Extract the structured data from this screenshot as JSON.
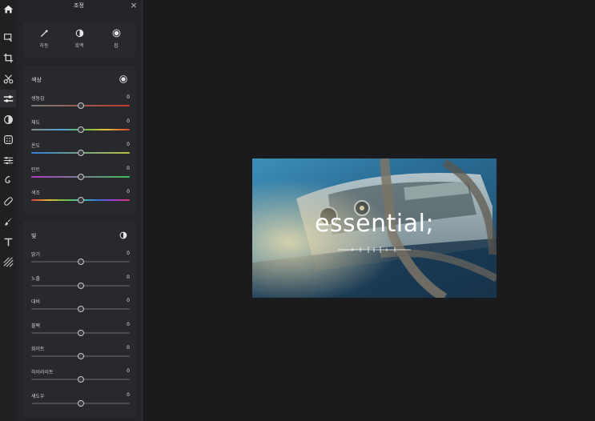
{
  "panel": {
    "title": "조정",
    "close_label": "×"
  },
  "quick_actions": [
    {
      "label": "자동",
      "icon": "magic-wand-icon"
    },
    {
      "label": "흑백",
      "icon": "contrast-icon"
    },
    {
      "label": "팝",
      "icon": "radial-icon"
    }
  ],
  "color_section": {
    "title": "색상",
    "icon": "color-wheel-icon",
    "sliders": [
      {
        "label": "생동감",
        "value": "0",
        "level": 0.5
      },
      {
        "label": "채도",
        "value": "0",
        "level": 0.5
      },
      {
        "label": "온도",
        "value": "0",
        "level": 0.5
      },
      {
        "label": "틴트",
        "value": "0",
        "level": 0.5
      },
      {
        "label": "색조",
        "value": "0",
        "level": 0.5
      }
    ]
  },
  "light_section": {
    "title": "빛",
    "icon": "half-circle-icon",
    "sliders": [
      {
        "label": "밝기",
        "value": "0",
        "level": 0.5
      },
      {
        "label": "노출",
        "value": "0",
        "level": 0.5
      },
      {
        "label": "대비",
        "value": "0",
        "level": 0.5
      },
      {
        "label": "블랙",
        "value": "0",
        "level": 0.5
      },
      {
        "label": "화이트",
        "value": "0",
        "level": 0.5
      },
      {
        "label": "하이라이트",
        "value": "0",
        "level": 0.5
      },
      {
        "label": "섀도우",
        "value": "0",
        "level": 0.5
      }
    ]
  },
  "rail_tools": [
    "home-icon",
    "select-icon",
    "crop-icon",
    "cut-icon",
    "adjust-icon",
    "filter-icon",
    "texture-icon",
    "effects-icon",
    "spiral-icon",
    "bandage-icon",
    "brush-icon",
    "text-icon",
    "pattern-icon"
  ],
  "preview": {
    "overlay_text": "essential;"
  },
  "colors": {
    "background": "#1b1b1d",
    "panel": "#232427",
    "card": "#28292d"
  }
}
